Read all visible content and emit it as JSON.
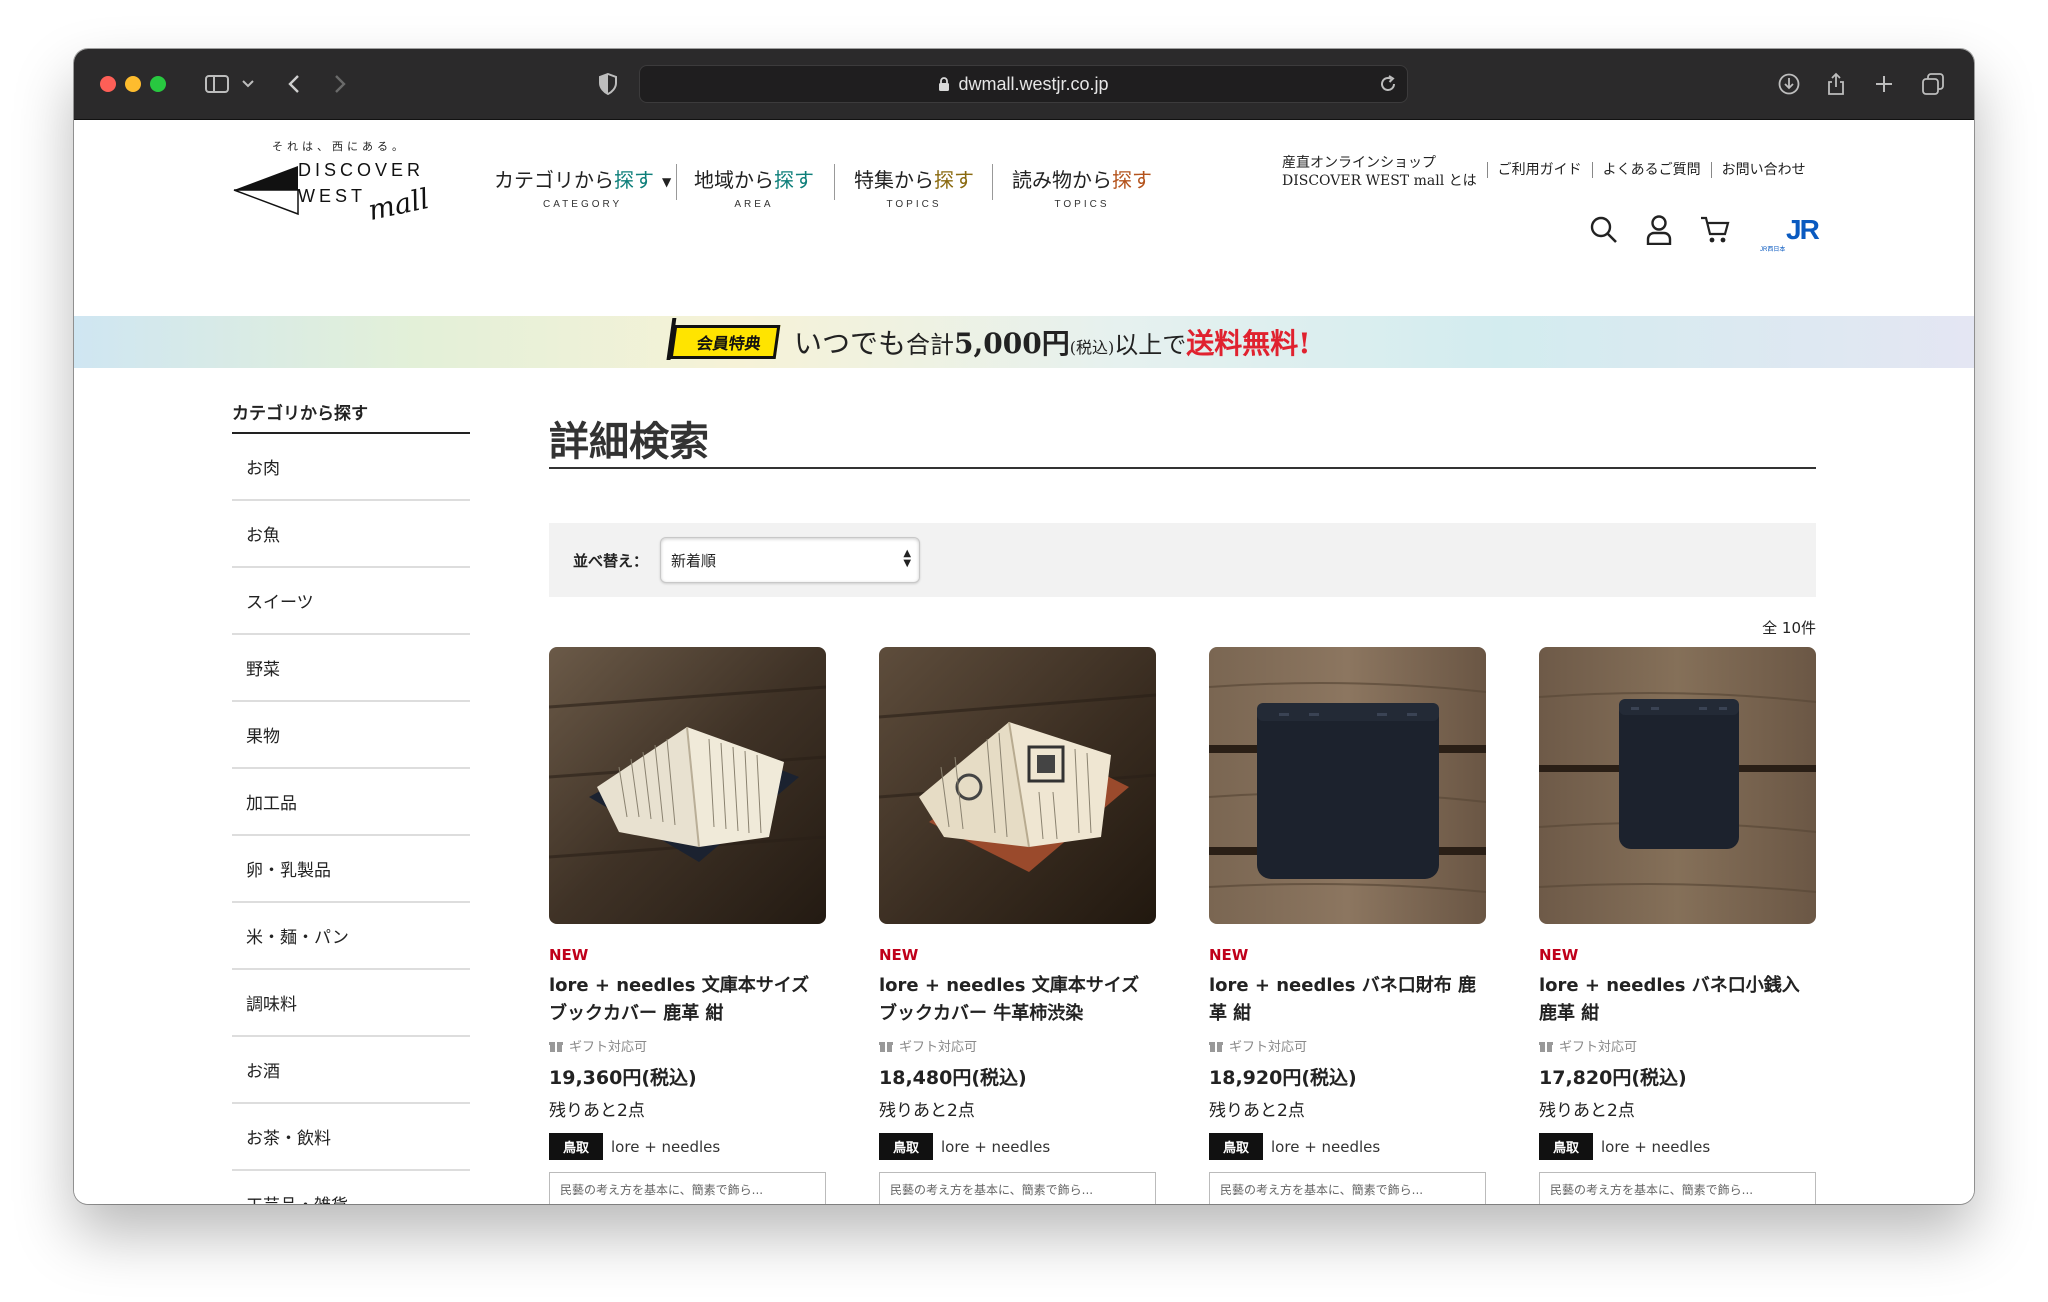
{
  "browser": {
    "url": "dwmall.westjr.co.jp"
  },
  "header": {
    "logo": {
      "tagline": "それは、西にある。",
      "word1": "DISCOVER",
      "word2": "WEST",
      "word3": "mall"
    },
    "nav": [
      {
        "pre": "カテゴリから",
        "hl": "探す",
        "en": "CATEGORY",
        "dropdown": "▼"
      },
      {
        "pre": "地域から",
        "hl": "探す",
        "en": "AREA"
      },
      {
        "pre": "特集から",
        "hl": "探す",
        "en": "TOPICS"
      },
      {
        "pre": "読み物から",
        "hl": "探す",
        "en": "TOPICS"
      }
    ],
    "util_links": {
      "about_line1": "産直オンラインショップ",
      "about_line2": "DISCOVER WEST mall とは",
      "guide": "ご利用ガイド",
      "faq": "よくあるご質問",
      "contact": "お問い合わせ"
    },
    "icons": [
      "search-icon",
      "user-icon",
      "cart-icon",
      "jr-logo"
    ],
    "jr_logo_text": "JR",
    "jr_logo_sub": "JR西日本"
  },
  "banner": {
    "badge": "会員特典",
    "text_pre": "いつでも",
    "text_total": "合計",
    "amount": "5,000円",
    "tax": "(税込)",
    "text_over": "以上で",
    "highlight": "送料無料!"
  },
  "sidebar": {
    "title": "カテゴリから探す",
    "items": [
      "お肉",
      "お魚",
      "スイーツ",
      "野菜",
      "果物",
      "加工品",
      "卵・乳製品",
      "米・麺・パン",
      "調味料",
      "お酒",
      "お茶・飲料",
      "工芸品・雑貨"
    ]
  },
  "main": {
    "title": "詳細検索",
    "sort_label": "並べ替え：",
    "sort_value": "新着順",
    "count": "全 10件",
    "products": [
      {
        "badge": "NEW",
        "title": "lore + needles 文庫本サイズ ブックカバー 鹿革 紺",
        "gift": "ギフト対応可",
        "price": "19,360円(税込)",
        "stock": "残りあと2点",
        "pref": "鳥取",
        "shop": "lore + needles",
        "desc": "民藝の考え方を基本に、簡素で飾ら..."
      },
      {
        "badge": "NEW",
        "title": "lore + needles 文庫本サイズ ブックカバー 牛革柿渋染",
        "gift": "ギフト対応可",
        "price": "18,480円(税込)",
        "stock": "残りあと2点",
        "pref": "鳥取",
        "shop": "lore + needles",
        "desc": "民藝の考え方を基本に、簡素で飾ら..."
      },
      {
        "badge": "NEW",
        "title": "lore + needles バネ口財布 鹿革 紺",
        "gift": "ギフト対応可",
        "price": "18,920円(税込)",
        "stock": "残りあと2点",
        "pref": "鳥取",
        "shop": "lore + needles",
        "desc": "民藝の考え方を基本に、簡素で飾ら..."
      },
      {
        "badge": "NEW",
        "title": "lore + needles バネ口小銭入 鹿革 紺",
        "gift": "ギフト対応可",
        "price": "17,820円(税込)",
        "stock": "残りあと2点",
        "pref": "鳥取",
        "shop": "lore + needles",
        "desc": "民藝の考え方を基本に、簡素で飾ら..."
      }
    ]
  },
  "colors": {
    "chrome": "#2b2a2b",
    "new_badge": "#c0001a",
    "banner_red": "#e0222f",
    "badge_yellow": "#ffe400"
  }
}
